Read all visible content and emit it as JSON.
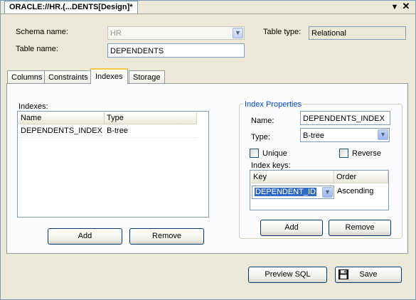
{
  "window": {
    "tab_title": "ORACLE://HR.(...DENTS[Design]*",
    "menu_icon": "triangle-down-icon",
    "close_icon": "close-icon"
  },
  "form": {
    "schema_label": "Schema name:",
    "schema_value": "HR",
    "table_label": "Table name:",
    "table_value": "DEPENDENTS",
    "type_label": "Table type:",
    "type_value": "Relational"
  },
  "tabs": [
    {
      "label": "Columns",
      "active": false
    },
    {
      "label": "Constraints",
      "active": false
    },
    {
      "label": "Indexes",
      "active": true
    },
    {
      "label": "Storage",
      "active": false
    }
  ],
  "indexes": {
    "label": "Indexes:",
    "columns": [
      "Name",
      "Type"
    ],
    "rows": [
      {
        "name": "DEPENDENTS_INDEX",
        "type": "B-tree"
      }
    ],
    "add_label": "Add",
    "remove_label": "Remove"
  },
  "index_properties": {
    "title": "Index Properties",
    "name_label": "Name:",
    "name_value": "DEPENDENTS_INDEX",
    "type_label": "Type:",
    "type_value": "B-tree",
    "unique_label": "Unique",
    "unique_checked": false,
    "reverse_label": "Reverse",
    "reverse_checked": false,
    "keys_label": "Index keys:",
    "key_columns": [
      "Key",
      "Order"
    ],
    "key_rows": [
      {
        "key": "DEPENDENT_ID",
        "order": "Ascending"
      }
    ],
    "add_label": "Add",
    "remove_label": "Remove"
  },
  "footer": {
    "preview_label": "Preview SQL",
    "save_label": "Save",
    "save_icon": "floppy-disk-icon"
  },
  "colors": {
    "accent": "#316ac5",
    "group_title": "#0046d5",
    "tab_highlight": "#ffc83c",
    "background": "#ece9d8"
  }
}
